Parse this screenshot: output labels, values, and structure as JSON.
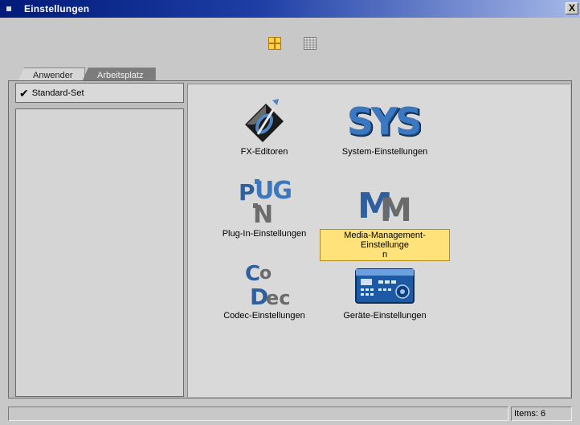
{
  "window": {
    "title": "Einstellungen",
    "close_glyph": "X"
  },
  "viewbar": {
    "active_view": "large-icons",
    "buttons": [
      "grid-large-icons-icon",
      "grid-list-icon"
    ]
  },
  "tabs": [
    {
      "label": "Anwender",
      "active": false
    },
    {
      "label": "Arbeitsplatz",
      "active": true
    }
  ],
  "left": {
    "selected_set": "Standard-Set",
    "check_glyph": "✔"
  },
  "items": [
    {
      "label": "FX-Editoren",
      "icon": "fx-editor-icon"
    },
    {
      "label": "System-Einstellungen",
      "icon": "sys-icon"
    },
    {
      "label": "Plug-In-Einstellungen",
      "icon": "plugin-icon"
    },
    {
      "label_line1": "Media-Management-Einstellunge",
      "label_line2": "n",
      "icon": "media-management-icon",
      "selected": true
    },
    {
      "label": "Codec-Einstellungen",
      "icon": "codec-icon"
    },
    {
      "label": "Geräte-Einstellungen",
      "icon": "device-icon"
    }
  ],
  "status": {
    "left": "",
    "items_count": "Items: 6"
  },
  "colors": {
    "title_blue": "#001a7a",
    "selection_yellow": "#ffe27a",
    "icon_blue": "#2f5f9e"
  }
}
